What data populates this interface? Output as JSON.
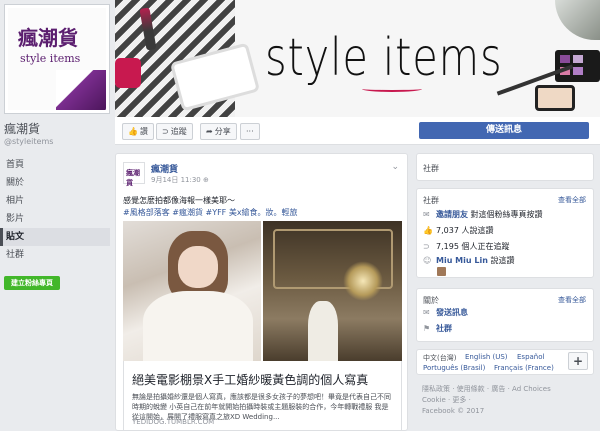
{
  "page": {
    "name": "瘋潮貨",
    "handle": "@styleitems",
    "logo_cn": "瘋潮貨",
    "logo_en": "style items",
    "cover_title": "style items"
  },
  "nav": {
    "items": [
      "首頁",
      "關於",
      "相片",
      "影片",
      "貼文",
      "社群"
    ],
    "active_index": 4,
    "create_label": "建立粉絲專頁"
  },
  "actions": {
    "like": "讚",
    "follow": "追蹤",
    "share": "分享",
    "more": "···",
    "send": "傳送訊息"
  },
  "post": {
    "author": "瘋潮貨",
    "time": "9月14日 11:30",
    "text_line": "感覺怎麼拍都像海報一樣美耶～",
    "tags": "#風格部落客 #瘋潮貨 #YFF 美x繪食。妝。輕旅",
    "link_title": "絕美電影棚景X手工婚紗暖黃色調的個人寫真",
    "link_desc": "無論是拍攝婚紗還是個人寫真，應該都是很多女孩子的夢想吧！畢竟是代表自己不同時期的蛻變 小英自己在前年就開始拍攝時裝或主題服裝的合作，今年轉戰禮服 我是從這開始，展開了禮服寫真之旅XD Wedding...",
    "link_domain": "YEDIDOG.TUMBLR.COM"
  },
  "right": {
    "top_card": "社群",
    "community": {
      "title": "社群",
      "see_all": "查看全部",
      "invite_link": "邀請朋友",
      "invite_text": " 對這個粉絲專頁按讚",
      "likes": "7,037 人說這讚",
      "follows": "7,195 個人正在追蹤",
      "friend_name": "Miu Miu Lin",
      "friend_text": " 說這讚"
    },
    "about": {
      "title": "關於",
      "see_all": "查看全部",
      "message": "發送訊息",
      "category": "社群"
    },
    "languages": {
      "current": "中文(台灣)",
      "others": [
        "English (US)",
        "Español",
        "Português (Brasil)",
        "Français (France)"
      ],
      "plus": "+"
    },
    "footer": {
      "line1": "隱私政策 · 使用條款 · 廣告 · Ad Choices",
      "line2": "Cookie · 更多 ·",
      "line3": "Facebook © 2017"
    }
  },
  "colors": {
    "brand": "#4267b2",
    "link": "#365899",
    "logo_purple": "#5b1e6f",
    "create_green": "#42b72a"
  }
}
